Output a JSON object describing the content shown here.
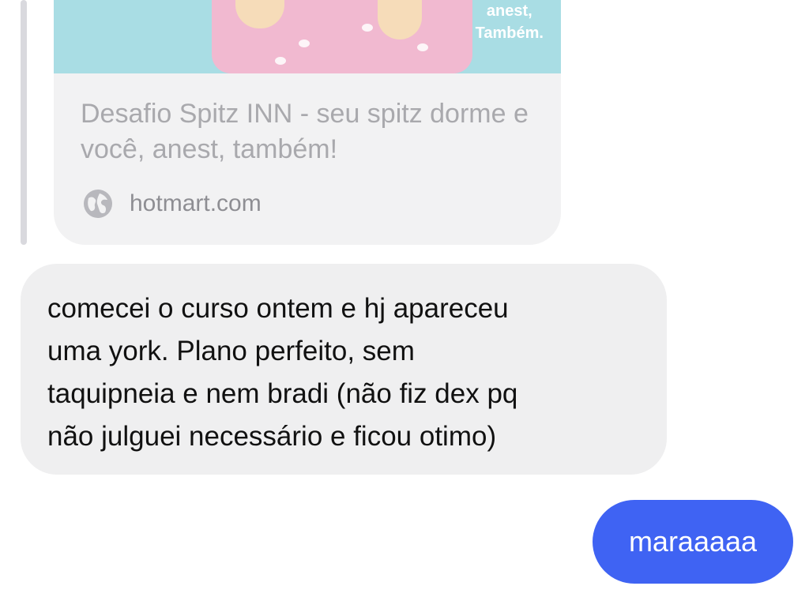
{
  "link_preview": {
    "image_text_line1": "anest,",
    "image_text_line2": "Também.",
    "title": "Desafio Spitz INN - seu spitz dorme e você, anest, também!",
    "domain": "hotmart.com",
    "domain_icon": "globe-icon"
  },
  "messages": [
    {
      "direction": "incoming",
      "text": "comecei o curso ontem e hj apareceu\numa york. Plano perfeito, sem\ntaquipneia e nem bradi (não fiz dex pq\nnão julguei necessário e ficou otimo)"
    },
    {
      "direction": "outgoing",
      "text": "maraaaaa"
    }
  ],
  "colors": {
    "incoming_bubble": "#efeff0",
    "outgoing_bubble": "#3f63f3",
    "card_background": "#f2f2f3",
    "card_image_background": "#a9dde4"
  }
}
